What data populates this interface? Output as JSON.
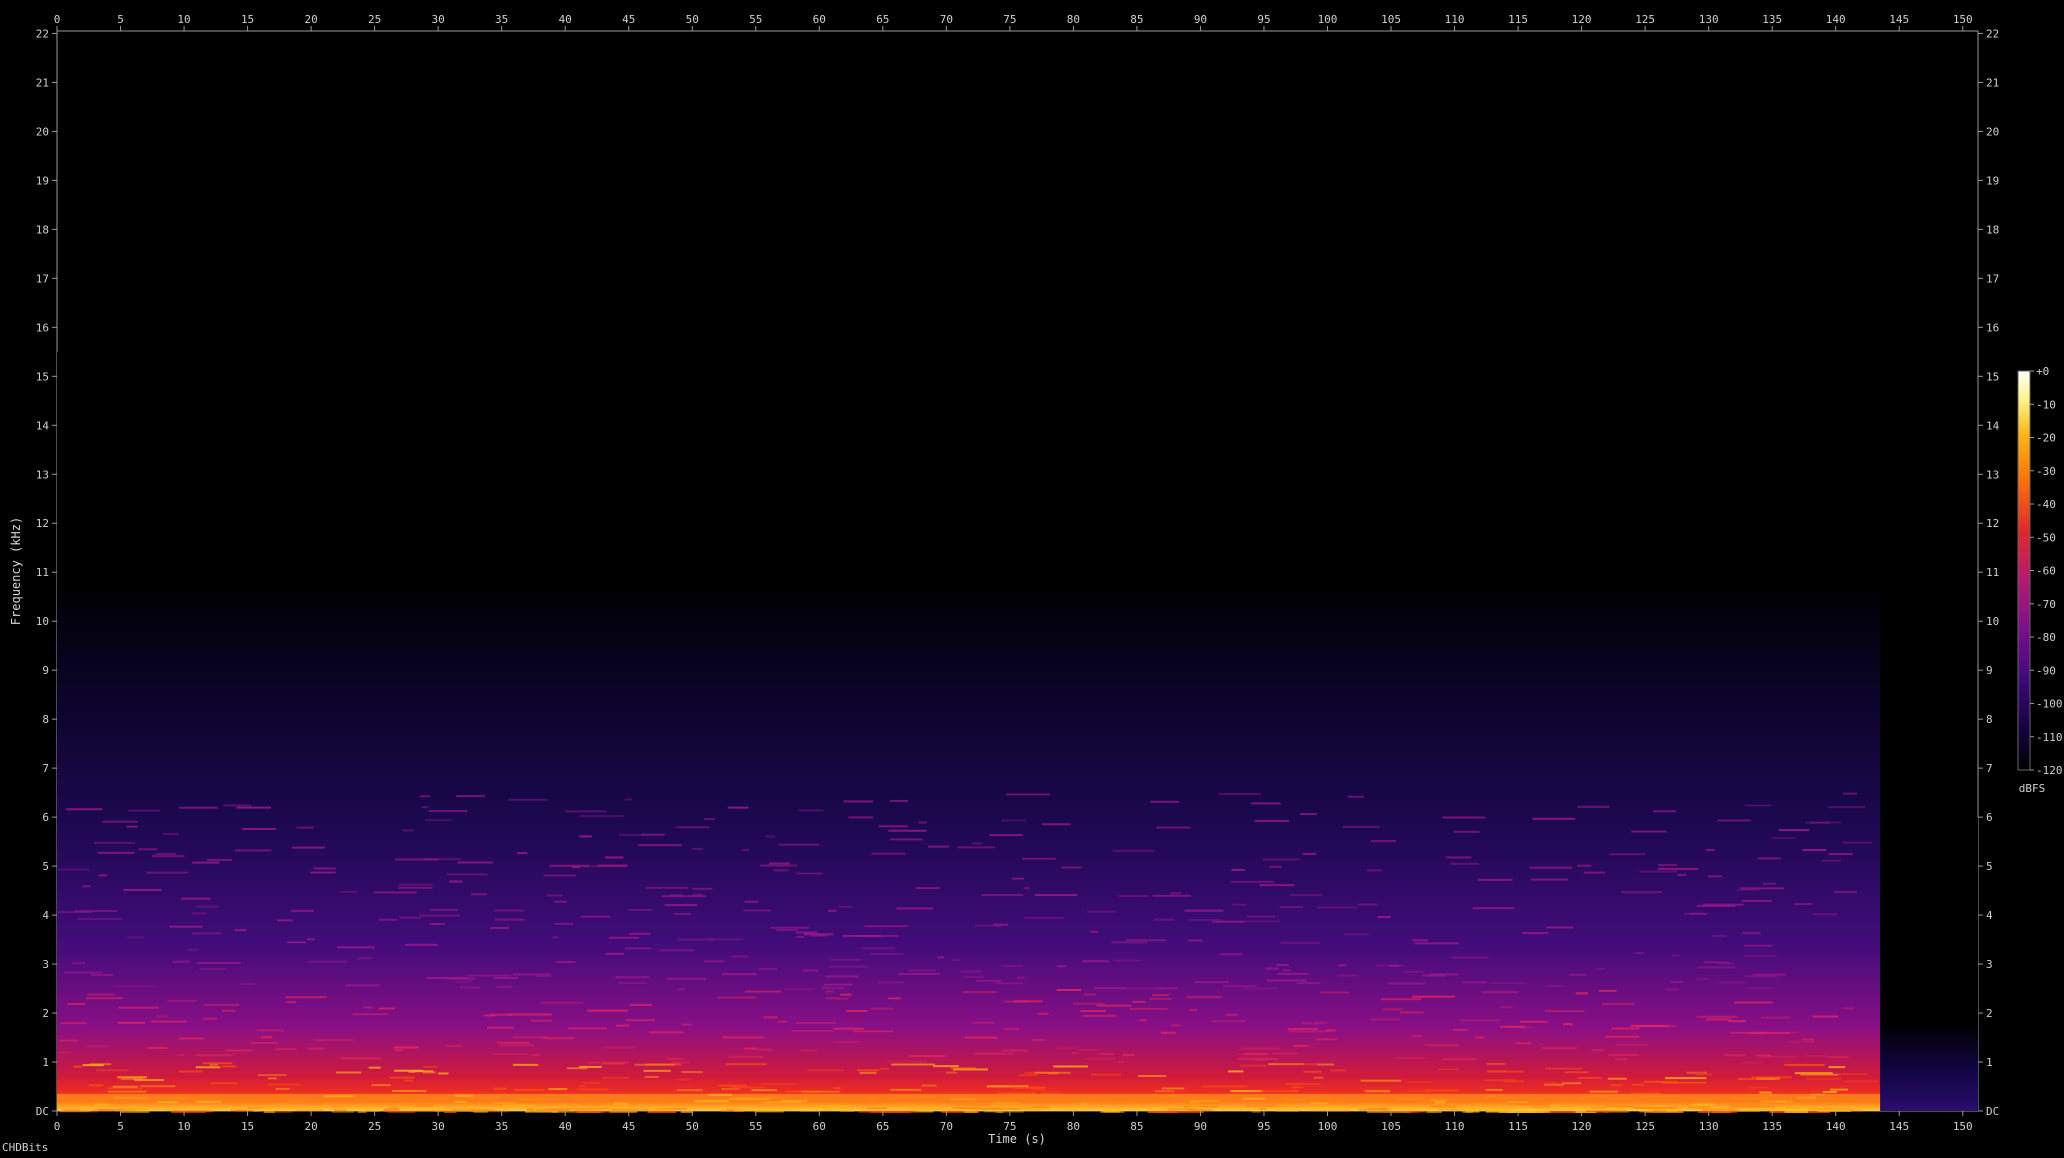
{
  "chart_data": {
    "type": "heatmap",
    "xlabel": "Time (s)",
    "ylabel": "Frequency (kHz)",
    "xlim": [
      0,
      151.2
    ],
    "ylim": [
      0,
      22.05
    ],
    "x_ticks": [
      0,
      5,
      10,
      15,
      20,
      25,
      30,
      35,
      40,
      45,
      50,
      55,
      60,
      65,
      70,
      75,
      80,
      85,
      90,
      95,
      100,
      105,
      110,
      115,
      120,
      125,
      130,
      135,
      140,
      145,
      150
    ],
    "y_ticks": [
      "DC",
      "1",
      "2",
      "3",
      "4",
      "5",
      "6",
      "7",
      "8",
      "9",
      "10",
      "11",
      "12",
      "13",
      "14",
      "15",
      "16",
      "17",
      "18",
      "19",
      "20",
      "21",
      "22"
    ],
    "colorbar": {
      "label": "dBFS",
      "range": [
        -120,
        0
      ],
      "ticks": [
        "+0",
        "-10",
        "-20",
        "-30",
        "-40",
        "-50",
        "-60",
        "-70",
        "-80",
        "-90",
        "-100",
        "-110",
        "-120"
      ],
      "colors": [
        "#000000",
        "#12043c",
        "#3c0878",
        "#7a0f8a",
        "#b51a6e",
        "#e3282b",
        "#fb6d0a",
        "#fdb515",
        "#fef48b",
        "#ffffff"
      ]
    },
    "content_cutoff_khz": 15.5,
    "music_end_s": 143.5,
    "duration_s": 151.2
  },
  "footer": {
    "text": "CHDBits"
  }
}
